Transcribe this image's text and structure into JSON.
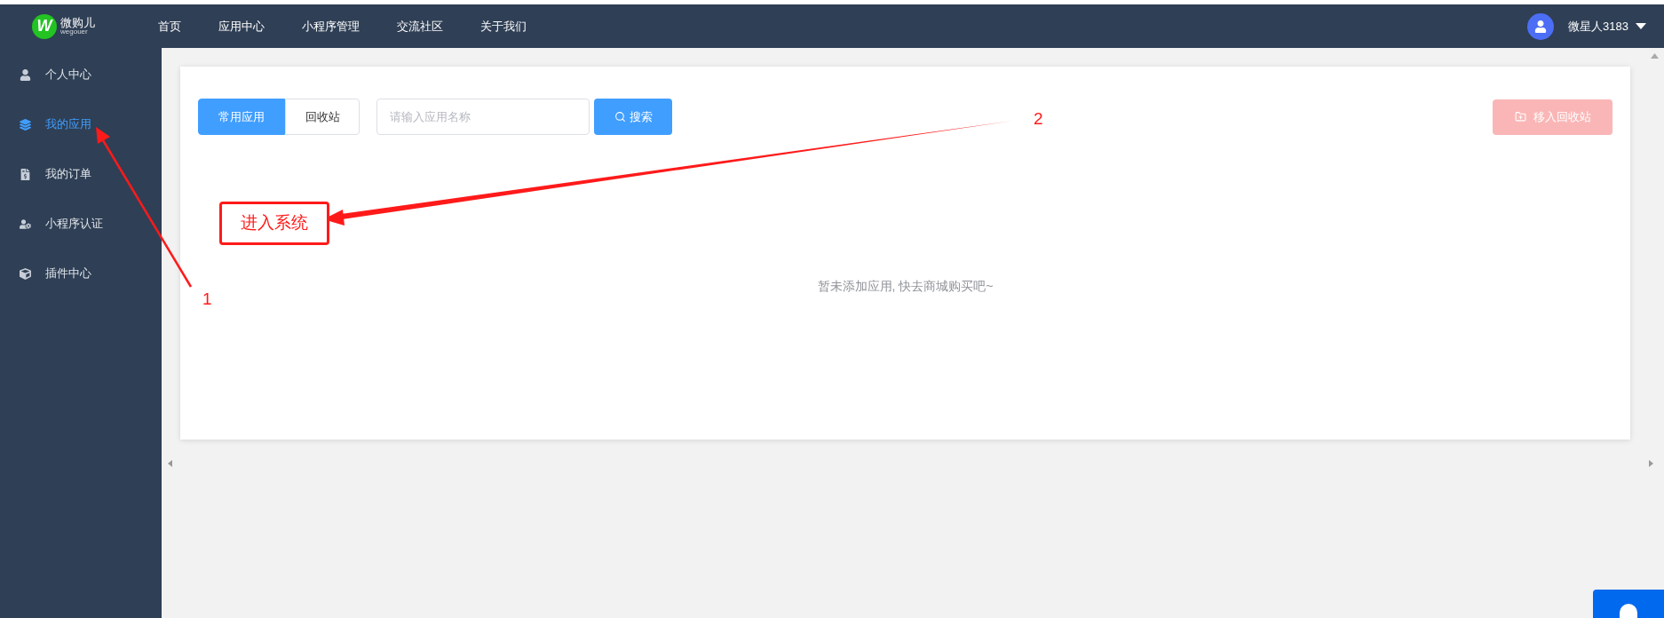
{
  "header": {
    "logo_text": "微购儿",
    "logo_sub": "wegouer",
    "logo_mark": "W",
    "nav": [
      "首页",
      "应用中心",
      "小程序管理",
      "交流社区",
      "关于我们"
    ],
    "user": "微星人3183"
  },
  "sidebar": {
    "items": [
      {
        "label": "个人中心",
        "selected": false
      },
      {
        "label": "我的应用",
        "selected": true
      },
      {
        "label": "我的订单",
        "selected": false
      },
      {
        "label": "小程序认证",
        "selected": false
      },
      {
        "label": "插件中心",
        "selected": false
      }
    ]
  },
  "toolbar": {
    "tabs": [
      {
        "label": "常用应用",
        "selected": true
      },
      {
        "label": "回收站",
        "selected": false
      }
    ],
    "search": {
      "placeholder": "请输入应用名称"
    },
    "search_button": "搜索",
    "move_button": {
      "label": "移入回收站",
      "disabled": true
    }
  },
  "empty_message": "暂未添加应用, 快去商城购买吧~",
  "annotations": {
    "box": "进入系统",
    "labels": [
      "1",
      "2"
    ]
  }
}
